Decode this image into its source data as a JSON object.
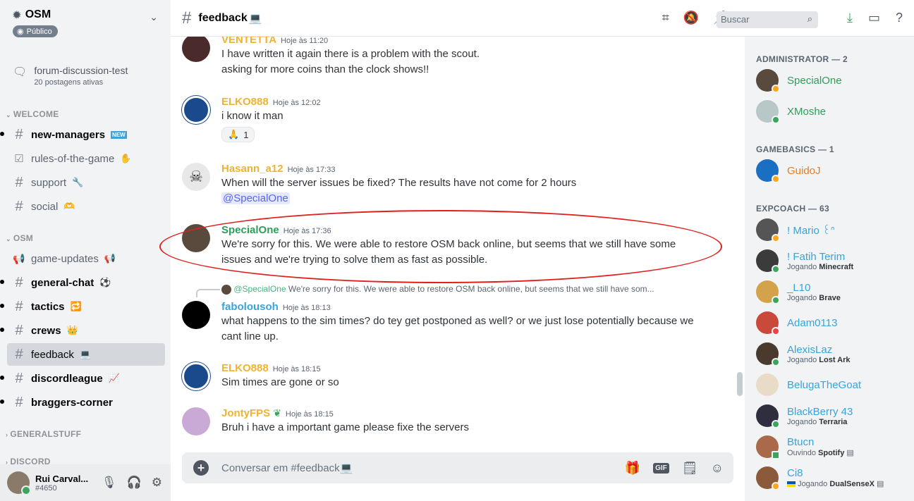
{
  "server": {
    "name": "OSM",
    "badge": "Público"
  },
  "forum": {
    "title": "forum-discussion-test",
    "subtitle": "20 postagens ativas"
  },
  "categories": {
    "welcome": "WELCOME",
    "osm": "OSM",
    "generalstuff": "GENERALSTUFF",
    "discord": "DISCORD"
  },
  "channels": {
    "new_managers": "new-managers",
    "rules": "rules-of-the-game",
    "support": "support",
    "social": "social",
    "game_updates": "game-updates",
    "general_chat": "general-chat",
    "tactics": "tactics",
    "crews": "crews",
    "feedback": "feedback",
    "discordleague": "discordleague",
    "braggers": "braggers-corner"
  },
  "user": {
    "name": "Rui Carval...",
    "tag": "#4650"
  },
  "topbar": {
    "channel": "feedback",
    "search_placeholder": "Buscar"
  },
  "messages": [
    {
      "author": "VENTETTA",
      "color": "#f0b232",
      "ts": "Hoje às 11:20",
      "lines": [
        "I have written it again there is a problem with the scout.",
        "asking for more coins than the clock shows!!"
      ]
    },
    {
      "author": "ELKO888",
      "color": "#f0b232",
      "ts": "Hoje às 12:02",
      "lines": [
        "i know it man"
      ],
      "reaction": {
        "emoji": "🙏",
        "count": "1"
      }
    },
    {
      "author": "Hasann_a12",
      "color": "#f0b232",
      "ts": "Hoje às 17:33",
      "lines": [
        "When will the server issues be fixed?  The results have not come for 2 hours"
      ],
      "mention": "@SpecialOne"
    },
    {
      "author": "SpecialOne",
      "color": "#2f9d5a",
      "ts": "Hoje às 17:36",
      "lines": [
        "We're sorry for this. We were able to restore OSM back online, but seems that we still have some",
        "issues and we're trying to solve them as fast as possible."
      ]
    },
    {
      "author": "fabolousoh",
      "color": "#3aa3d9",
      "ts": "Hoje às 18:13",
      "reply_name": "@SpecialOne",
      "reply_text": "We're sorry for this. We were able to restore OSM back online, but seems that we still have som...",
      "lines": [
        "what happens to the sim times? do tey get postponed as well? or we just lose potentially because we",
        "cant line up."
      ]
    },
    {
      "author": "ELKO888",
      "color": "#f0b232",
      "ts": "Hoje às 18:15",
      "lines": [
        "Sim times are gone or so"
      ]
    },
    {
      "author": "JontyFPS",
      "color": "#f0b232",
      "ts": "Hoje às 18:15",
      "lines": [
        "Bruh i have a important game please fixe the servers"
      ]
    }
  ],
  "composer": {
    "placeholder": "Conversar em #feedback💻"
  },
  "member_groups": {
    "admin": "ADMINISTRATOR — 2",
    "gamebasics": "GAMEBASICS — 1",
    "expcoach": "EXPCOACH — 63"
  },
  "members": [
    {
      "name": "SpecialOne",
      "color": "#2f9d5a",
      "activity": ""
    },
    {
      "name": "XMoshe",
      "color": "#2f9d5a",
      "activity": ""
    },
    {
      "name": "GuidoJ",
      "color": "#e67e22",
      "activity": ""
    },
    {
      "name": "! Mario ꒰ᐢ",
      "color": "#3aa3d9",
      "activity": ""
    },
    {
      "name": "! Fatih Terim",
      "color": "#3aa3d9",
      "activity_prefix": "Jogando ",
      "activity": "Minecraft"
    },
    {
      "name": "_L10",
      "color": "#3aa3d9",
      "activity_prefix": "Jogando ",
      "activity": "Brave"
    },
    {
      "name": "Adam0113",
      "color": "#3aa3d9",
      "activity": ""
    },
    {
      "name": "AlexisLaz",
      "color": "#3aa3d9",
      "activity_prefix": "Jogando ",
      "activity": "Lost Ark"
    },
    {
      "name": "BelugaTheGoat",
      "color": "#3aa3d9",
      "activity": ""
    },
    {
      "name": "BlackBerry 43",
      "color": "#3aa3d9",
      "activity_prefix": "Jogando ",
      "activity": "Terraria"
    },
    {
      "name": "Btucn",
      "color": "#3aa3d9",
      "activity_prefix": "Ouvindo ",
      "activity": "Spotify"
    },
    {
      "name": "Ci8",
      "color": "#3aa3d9",
      "activity_prefix": "Jogando ",
      "activity": "DualSenseX"
    }
  ]
}
